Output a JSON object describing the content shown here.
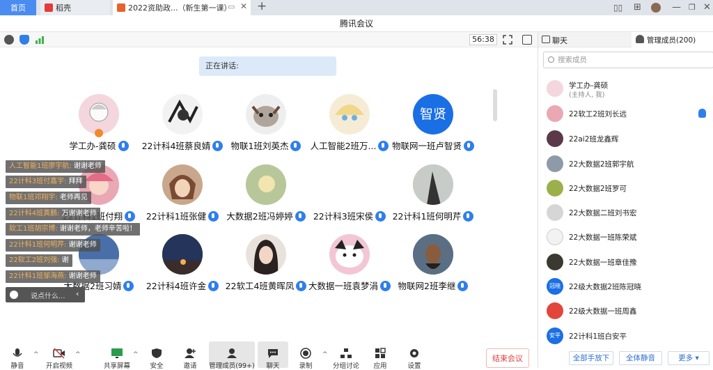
{
  "browser": {
    "tabs": [
      "首页",
      "稻壳",
      "2022资助政...（新生第一课）"
    ],
    "new_tab": "+"
  },
  "window": {
    "title": "腾讯会议"
  },
  "meeting": {
    "timer": "56:38",
    "speaking_label": "正在讲话:"
  },
  "panel": {
    "chat_tab": "聊天",
    "members_tab": "管理成员(200)",
    "search_placeholder": "搜索成员",
    "members": [
      {
        "name": "学工办-龚硕",
        "sub": "(主持人, 我)"
      },
      {
        "name": "22软工2班刘长远"
      },
      {
        "name": "22ai2班龙鑫辉"
      },
      {
        "name": "22大数据2班郭宇航"
      },
      {
        "name": "22大数据2班罗可"
      },
      {
        "name": "22大数据二班刘书宏"
      },
      {
        "name": "22大数据一班陈荣斌"
      },
      {
        "name": "22大数据一班章佳豫"
      },
      {
        "name": "22级大数据2班陈冠晓",
        "avatar_text": "冠晓"
      },
      {
        "name": "22级大数据一班周鑫"
      },
      {
        "name": "22计科1班白安平",
        "avatar_text": "安平"
      }
    ],
    "buttons": {
      "mute_all_hands": "全部手放下",
      "mute_all": "全体静音",
      "more": "更多"
    }
  },
  "grid": [
    {
      "name": "学工办-龚硕"
    },
    {
      "name": "22计科4班蔡良婧"
    },
    {
      "name": "物联1班刘英杰"
    },
    {
      "name": "人工智能2班万..."
    },
    {
      "name": "物联网一班卢智贤",
      "avatar_text": "智贤"
    },
    {
      "name": "22计科1班付翔"
    },
    {
      "name": "22计科1班张健"
    },
    {
      "name": "大数据2班冯婷婷"
    },
    {
      "name": "22计科3班宋侯"
    },
    {
      "name": "22计科1班何明芹"
    },
    {
      "name": "大数据2班习婧"
    },
    {
      "name": "22计科4班许金"
    },
    {
      "name": "22软工4班黄晖凤"
    },
    {
      "name": "大数据一班袁梦涓"
    },
    {
      "name": "物联网2班李继"
    }
  ],
  "chat": [
    {
      "user": "人工智能1班廖宇航:",
      "msg": "谢谢老师"
    },
    {
      "user": "22计科3班付嘉宇:",
      "msg": "拜拜"
    },
    {
      "user": "物联1班邓翔宇:",
      "msg": "老师再见"
    },
    {
      "user": "22计科4班黄鹏:",
      "msg": "万谢谢老师"
    },
    {
      "user": "软工1班胡宗博:",
      "msg": "谢谢老师，老师辛苦啦！"
    },
    {
      "user": "22计科1班何明芹:",
      "msg": "谢谢老师"
    },
    {
      "user": "22软工2班刘强:",
      "msg": "谢"
    },
    {
      "user": "22计科1班邹海燕:",
      "msg": "谢谢老师"
    }
  ],
  "chat_input_placeholder": "说点什么...",
  "toolbar": {
    "mute": "静音",
    "video": "开启视频",
    "share": "共享屏幕",
    "security": "安全",
    "invite": "邀请",
    "members": "管理成员(99+)",
    "chat": "聊天",
    "record": "录制",
    "breakout": "分组讨论",
    "apps": "应用",
    "settings": "设置",
    "end": "结束会议"
  }
}
